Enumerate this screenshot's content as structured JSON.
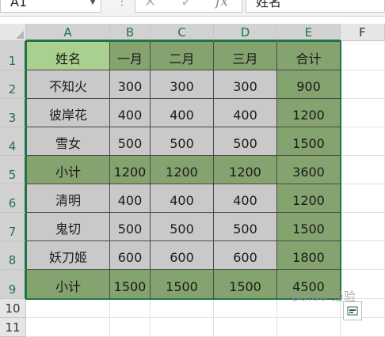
{
  "formula_bar": {
    "name_box": "A1",
    "formula_value": "姓名",
    "fx_label": "fx",
    "cancel_symbol": "✕",
    "enter_symbol": "✓"
  },
  "columns": [
    "A",
    "B",
    "C",
    "D",
    "E",
    "F"
  ],
  "rows": [
    "1",
    "2",
    "3",
    "4",
    "5",
    "6",
    "7",
    "8",
    "9",
    "10",
    "11"
  ],
  "table": {
    "headers": [
      "姓名",
      "一月",
      "二月",
      "三月",
      "合计"
    ],
    "rows": [
      [
        "不知火",
        "300",
        "300",
        "300",
        "900"
      ],
      [
        "彼岸花",
        "400",
        "400",
        "400",
        "1200"
      ],
      [
        "雪女",
        "500",
        "500",
        "500",
        "1500"
      ],
      [
        "小计",
        "1200",
        "1200",
        "1200",
        "3600"
      ],
      [
        "清明",
        "400",
        "400",
        "400",
        "1200"
      ],
      [
        "鬼切",
        "500",
        "500",
        "500",
        "1500"
      ],
      [
        "妖刀姬",
        "600",
        "600",
        "600",
        "1800"
      ],
      [
        "小计",
        "1500",
        "1500",
        "1500",
        "4500"
      ]
    ]
  },
  "colors": {
    "header_first": "#a9d08e",
    "header_green": "#84a36e",
    "subtotal_green": "#84a36e",
    "total_col_green": "#84a36e",
    "normal_gray": "#c9c9c9",
    "selection": "#217346"
  },
  "watermark": "Baidu 经验",
  "quick_analysis_icon": "quick-analysis-icon"
}
